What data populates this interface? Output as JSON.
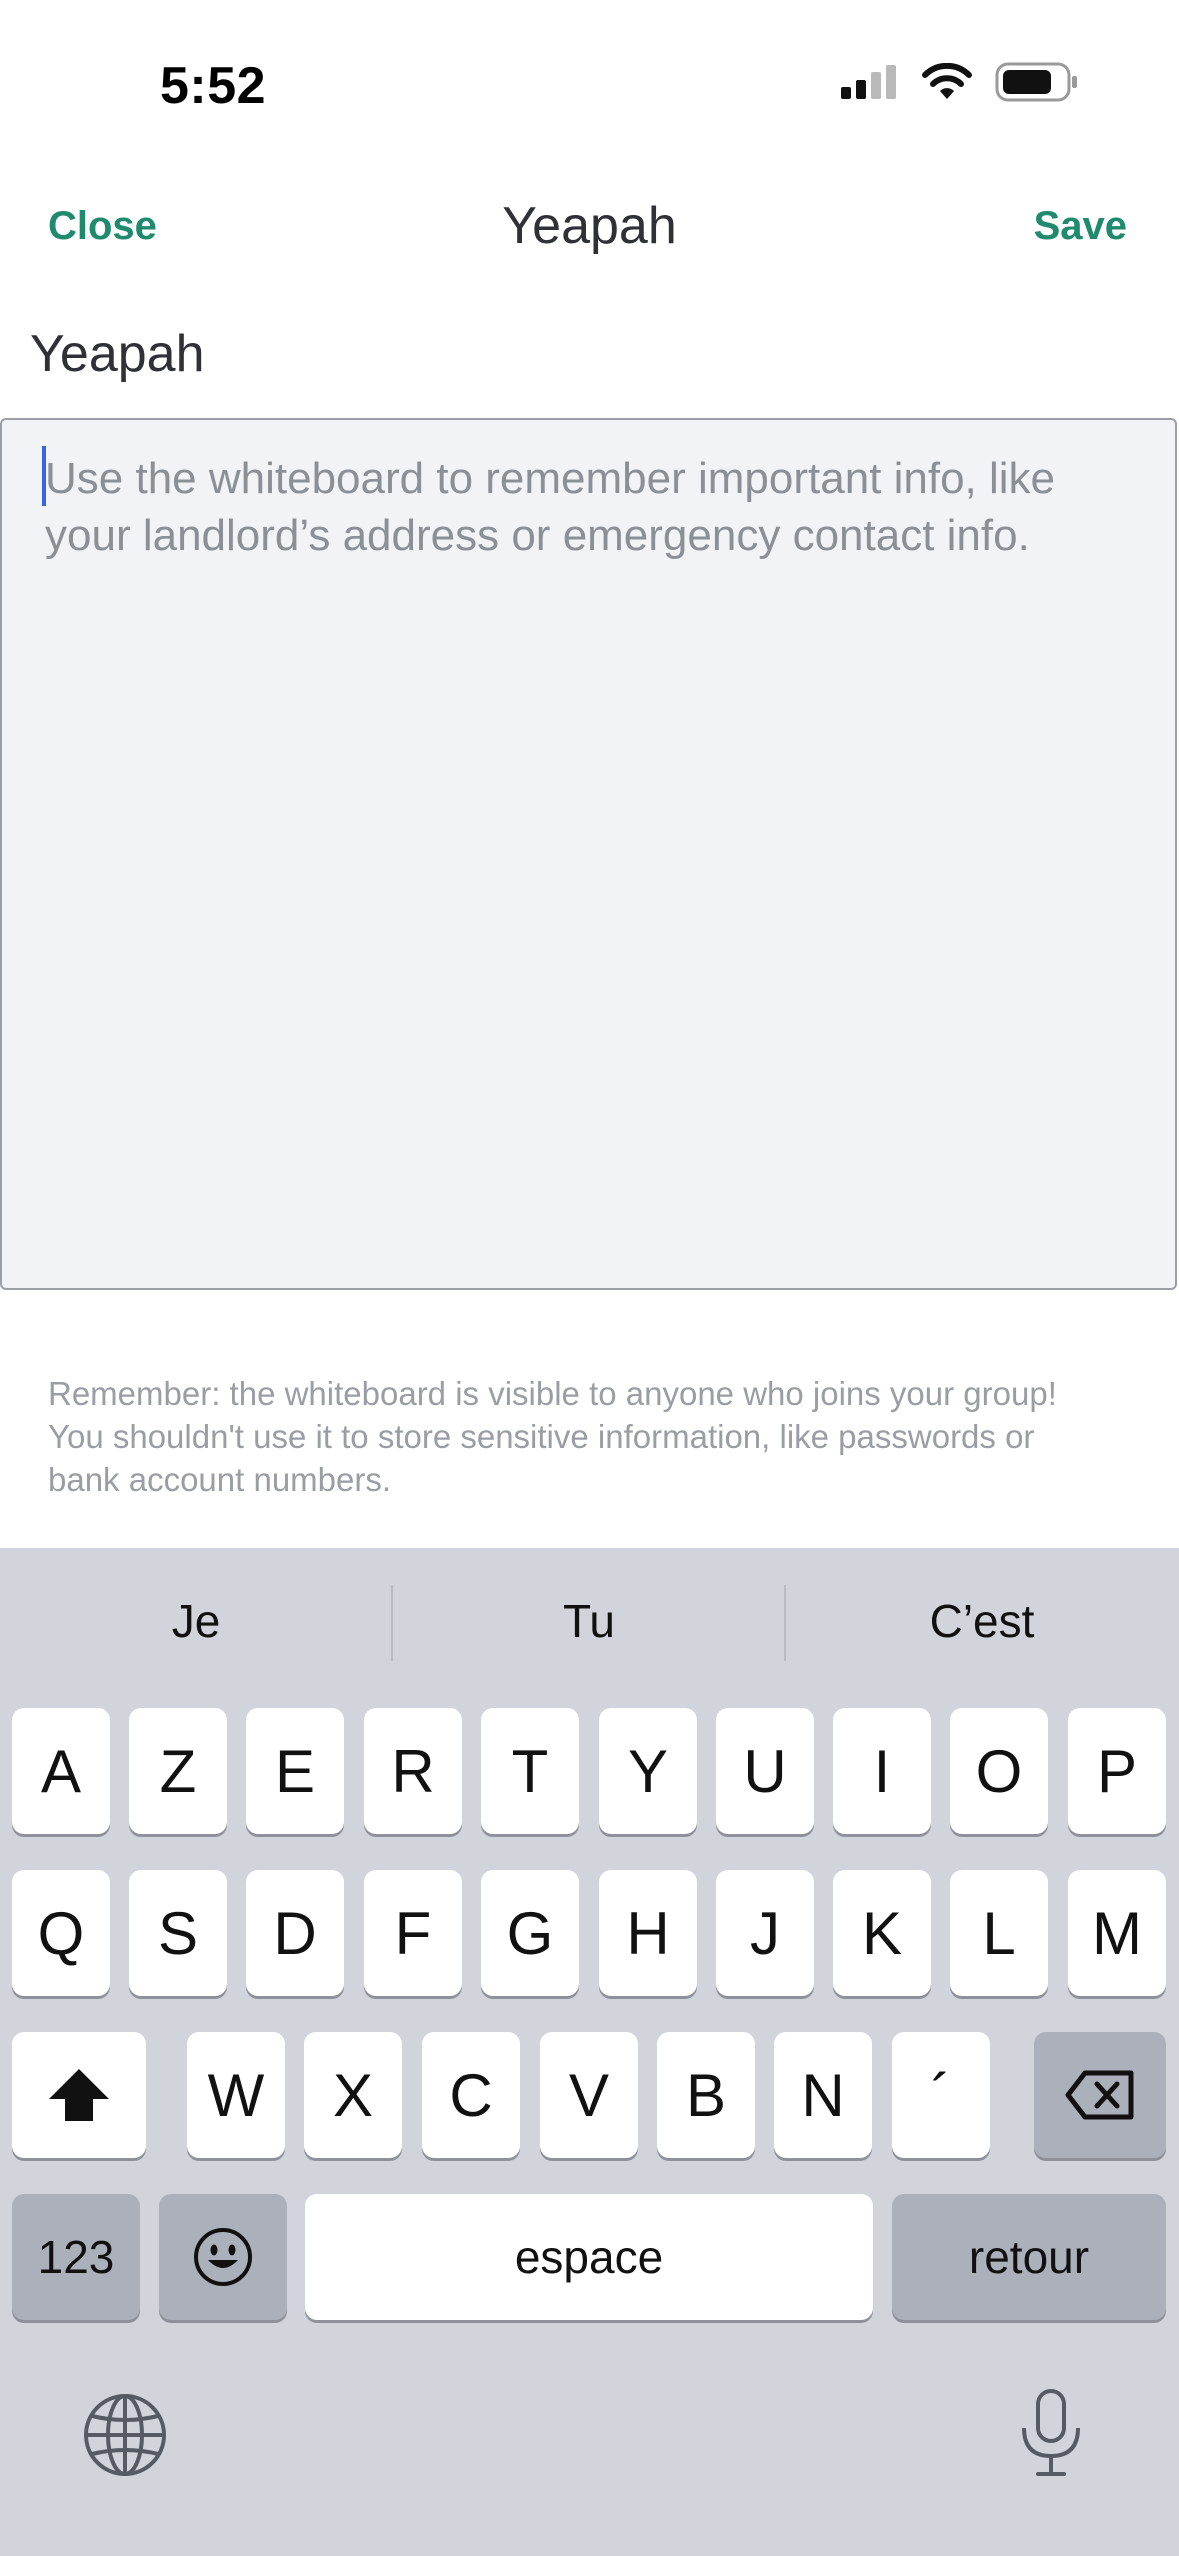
{
  "status_bar": {
    "time": "5:52"
  },
  "nav": {
    "close_label": "Close",
    "title": "Yeapah",
    "save_label": "Save"
  },
  "board": {
    "name": "Yeapah",
    "placeholder": "Use the whiteboard to remember important info, like your landlord’s address or emergency contact info."
  },
  "warning": "Remember: the whiteboard is visible to anyone who joins your group! You shouldn't use it to store sensitive information, like passwords or bank account numbers.",
  "keyboard": {
    "suggestions": [
      "Je",
      "Tu",
      "C’est"
    ],
    "row1": [
      "A",
      "Z",
      "E",
      "R",
      "T",
      "Y",
      "U",
      "I",
      "O",
      "P"
    ],
    "row2": [
      "Q",
      "S",
      "D",
      "F",
      "G",
      "H",
      "J",
      "K",
      "L",
      "M"
    ],
    "row3": [
      "W",
      "X",
      "C",
      "V",
      "B",
      "N",
      "´"
    ],
    "numbers_label": "123",
    "space_label": "espace",
    "return_label": "retour"
  },
  "icons": {
    "signal": "signal-icon",
    "wifi": "wifi-icon",
    "battery": "battery-icon",
    "shift": "shift-icon",
    "backspace": "backspace-icon",
    "emoji": "emoji-icon",
    "globe": "globe-icon",
    "microphone": "microphone-icon"
  },
  "colors": {
    "accent": "#1f8a6d",
    "caret": "#3c63d9",
    "keyboard_bg": "#d1d4db"
  }
}
